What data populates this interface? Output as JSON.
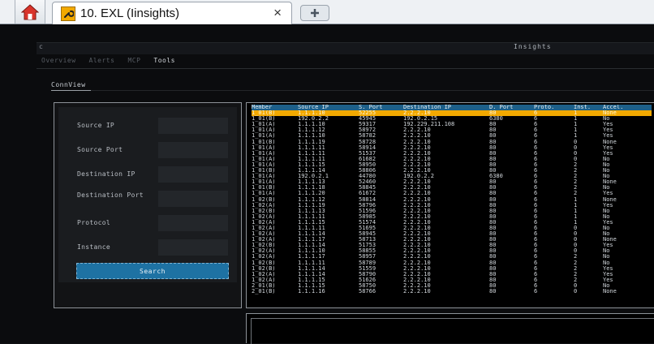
{
  "browser": {
    "tab_title": "10. EXL (Iinsights)",
    "tab_close": "×"
  },
  "app": {
    "title_left": "c",
    "title_center": "Insights",
    "nav": [
      {
        "label": "Overview"
      },
      {
        "label": "Alerts"
      },
      {
        "label": "MCP"
      },
      {
        "label": "Tools"
      }
    ],
    "active_nav": "Tools",
    "sub_nav": "ConnView"
  },
  "form": {
    "fields": [
      {
        "label": "Source IP",
        "value": ""
      },
      {
        "label": "Source Port",
        "value": ""
      },
      {
        "label": "Destination IP",
        "value": ""
      },
      {
        "label": "Destination Port",
        "value": ""
      },
      {
        "label": "Protocol",
        "value": ""
      },
      {
        "label": "Instance",
        "value": ""
      }
    ],
    "search_label": "Search"
  },
  "table": {
    "columns": [
      "Member",
      "Source IP",
      "S. Port",
      "Destination IP",
      "D. Port",
      "Proto.",
      "Inst.",
      "Accel."
    ],
    "selected_row": 0,
    "rows": [
      [
        "1_01(B)",
        "1.1.1.10",
        "52255",
        "2.2.2.10",
        "80",
        "6",
        "1",
        "None"
      ],
      [
        "1_01(B)",
        "192.0.2.2",
        "45945",
        "192.0.2.15",
        "6380",
        "6",
        "1",
        "No"
      ],
      [
        "1_01(A)",
        "1.1.1.10",
        "59317",
        "192.229.211.108",
        "80",
        "6",
        "1",
        "Yes"
      ],
      [
        "1_01(A)",
        "1.1.1.12",
        "58972",
        "2.2.2.10",
        "80",
        "6",
        "1",
        "Yes"
      ],
      [
        "1_01(A)",
        "1.1.1.10",
        "58782",
        "2.2.2.10",
        "80",
        "6",
        "1",
        "Yes"
      ],
      [
        "1_01(B)",
        "1.1.1.19",
        "58728",
        "2.2.2.10",
        "80",
        "6",
        "0",
        "None"
      ],
      [
        "1_01(A)",
        "1.1.1.11",
        "58914",
        "2.2.2.10",
        "80",
        "6",
        "0",
        "Yes"
      ],
      [
        "1_01(A)",
        "1.1.1.11",
        "51537",
        "2.2.2.10",
        "80",
        "6",
        "0",
        "Yes"
      ],
      [
        "1_01(A)",
        "1.1.1.11",
        "61682",
        "2.2.2.10",
        "80",
        "6",
        "0",
        "No"
      ],
      [
        "1_01(A)",
        "1.1.1.15",
        "58950",
        "2.2.2.10",
        "80",
        "6",
        "2",
        "No"
      ],
      [
        "1_01(B)",
        "1.1.1.14",
        "58806",
        "2.2.2.10",
        "80",
        "6",
        "2",
        "No"
      ],
      [
        "1_01(A)",
        "192.0.2.1",
        "44780",
        "192.0.2.2",
        "6380",
        "6",
        "2",
        "No"
      ],
      [
        "1_01(A)",
        "1.1.1.13",
        "52460",
        "2.2.2.10",
        "80",
        "6",
        "2",
        "None"
      ],
      [
        "1_01(B)",
        "1.1.1.18",
        "58845",
        "2.2.2.10",
        "80",
        "6",
        "2",
        "No"
      ],
      [
        "1_01(A)",
        "1.1.1.20",
        "61672",
        "2.2.2.10",
        "80",
        "6",
        "2",
        "Yes"
      ],
      [
        "1_02(B)",
        "1.1.1.12",
        "58814",
        "2.2.2.10",
        "80",
        "6",
        "1",
        "None"
      ],
      [
        "1_02(A)",
        "1.1.1.19",
        "58796",
        "2.2.2.10",
        "80",
        "6",
        "1",
        "Yes"
      ],
      [
        "1_02(B)",
        "1.1.1.13",
        "51596",
        "2.2.2.10",
        "80",
        "6",
        "1",
        "No"
      ],
      [
        "1_02(A)",
        "1.1.1.11",
        "58985",
        "2.2.2.10",
        "80",
        "6",
        "1",
        "No"
      ],
      [
        "1_02(A)",
        "1.1.1.15",
        "51574",
        "2.2.2.10",
        "80",
        "6",
        "1",
        "Yes"
      ],
      [
        "1_02(A)",
        "1.1.1.11",
        "51695",
        "2.2.2.10",
        "80",
        "6",
        "0",
        "No"
      ],
      [
        "1_02(A)",
        "1.1.1.14",
        "58945",
        "2.2.2.10",
        "80",
        "6",
        "0",
        "No"
      ],
      [
        "1_02(A)",
        "1.1.1.17",
        "58713",
        "2.2.2.10",
        "80",
        "6",
        "0",
        "None"
      ],
      [
        "1_02(B)",
        "1.1.1.14",
        "51753",
        "2.2.2.10",
        "80",
        "6",
        "0",
        "Yes"
      ],
      [
        "1_02(A)",
        "1.1.1.10",
        "58855",
        "2.2.2.10",
        "80",
        "6",
        "0",
        "No"
      ],
      [
        "1_02(A)",
        "1.1.1.17",
        "58957",
        "2.2.2.10",
        "80",
        "6",
        "2",
        "No"
      ],
      [
        "1_02(B)",
        "1.1.1.11",
        "58789",
        "2.2.2.10",
        "80",
        "6",
        "2",
        "No"
      ],
      [
        "1_02(B)",
        "1.1.1.14",
        "51559",
        "2.2.2.10",
        "80",
        "6",
        "2",
        "Yes"
      ],
      [
        "1_02(A)",
        "1.1.1.14",
        "58790",
        "2.2.2.10",
        "80",
        "6",
        "2",
        "Yes"
      ],
      [
        "1_02(A)",
        "1.1.1.15",
        "51626",
        "2.2.2.10",
        "80",
        "6",
        "2",
        "Yes"
      ],
      [
        "2_01(B)",
        "1.1.1.15",
        "58750",
        "2.2.2.10",
        "80",
        "6",
        "0",
        "No"
      ],
      [
        "2_01(B)",
        "1.1.1.16",
        "58766",
        "2.2.2.10",
        "80",
        "6",
        "0",
        "None"
      ]
    ]
  }
}
